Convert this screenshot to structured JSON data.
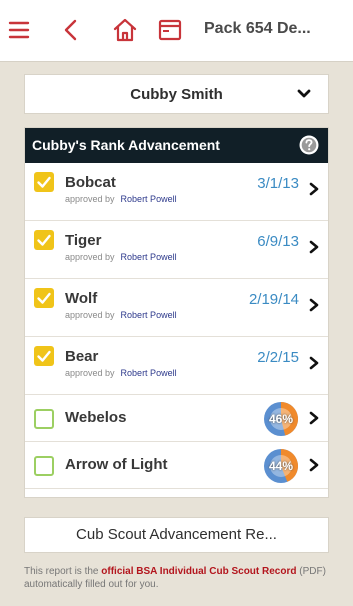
{
  "header": {
    "title": "Pack 654 De...",
    "icons": [
      "menu-icon",
      "back-icon",
      "home-icon",
      "window-icon"
    ],
    "accent_color": "#c8343a"
  },
  "scout": {
    "name": "Cubby Smith"
  },
  "rank_advancement": {
    "title": "Cubby's Rank Advancement",
    "ranks": [
      {
        "name": "Bobcat",
        "completed": true,
        "approved_prefix": "approved by",
        "approver": "Robert Powell",
        "date": "3/1/13"
      },
      {
        "name": "Tiger",
        "completed": true,
        "approved_prefix": "approved by",
        "approver": "Robert Powell",
        "date": "6/9/13"
      },
      {
        "name": "Wolf",
        "completed": true,
        "approved_prefix": "approved by",
        "approver": "Robert Powell",
        "date": "2/19/14"
      },
      {
        "name": "Bear",
        "completed": true,
        "approved_prefix": "approved by",
        "approver": "Robert Powell",
        "date": "2/2/15"
      },
      {
        "name": "Webelos",
        "completed": false,
        "progress_label": "46%",
        "progress": 0.46
      },
      {
        "name": "Arrow of Light",
        "completed": false,
        "progress_label": "44%",
        "progress": 0.44
      }
    ]
  },
  "report": {
    "button_label": "Cub Scout Advancement Re...",
    "note_prefix": "This report is the ",
    "note_highlight": "official BSA Individual Cub Scout Record",
    "note_suffix": " (PDF) automatically filled out for you."
  },
  "colors": {
    "date_blue": "#3b8bc3",
    "checkbox_yellow": "#f0c419",
    "checkbox_green": "#9ccf62",
    "progress_orange": "#f08a2c",
    "progress_blue": "#5b8fd0"
  }
}
